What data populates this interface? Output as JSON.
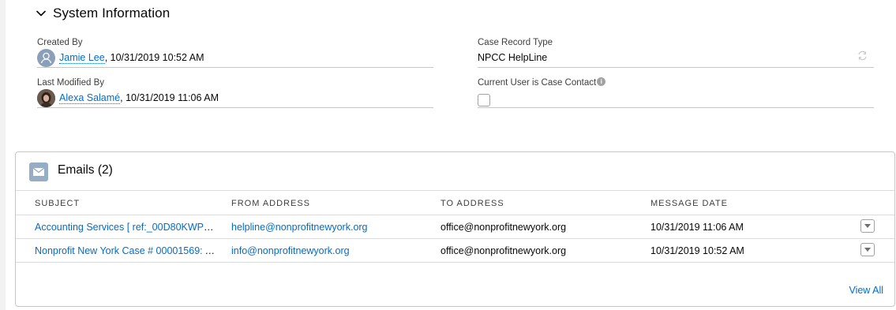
{
  "system_info": {
    "title": "System Information",
    "created_by": {
      "label": "Created By",
      "user": "Jamie Lee",
      "timestamp": ", 10/31/2019 10:52 AM"
    },
    "last_modified_by": {
      "label": "Last Modified By",
      "user": "Alexa Salamé",
      "timestamp": ", 10/31/2019 11:06 AM"
    },
    "case_record_type": {
      "label": "Case Record Type",
      "value": "NPCC HelpLine"
    },
    "current_user_is_case_contact": {
      "label": "Current User is Case Contact",
      "checked": false
    }
  },
  "emails": {
    "title": "Emails (2)",
    "columns": [
      "SUBJECT",
      "FROM ADDRESS",
      "TO ADDRESS",
      "MESSAGE DATE"
    ],
    "rows": [
      {
        "subject": "Accounting Services [ ref:_00D80KWPC._...",
        "from": "helpline@nonprofitnewyork.org",
        "to": "office@nonprofitnewyork.org",
        "date": "10/31/2019 11:06 AM"
      },
      {
        "subject": "Nonprofit New York Case # 00001569: Acc...",
        "from": "info@nonprofitnewyork.org",
        "to": "office@nonprofitnewyork.org",
        "date": "10/31/2019 10:52 AM"
      }
    ],
    "view_all": "View All"
  },
  "colors": {
    "link": "#006dcc",
    "email_icon_bg": "#95aec5",
    "border": "#c9c7c5"
  },
  "icons": {
    "section_toggle": "chevron-down-icon",
    "avatar_generic": "user-avatar-icon",
    "info": "info-icon",
    "record_type": "change-record-type-icon",
    "emails": "email-icon",
    "row_menu": "dropdown-arrow-icon"
  }
}
